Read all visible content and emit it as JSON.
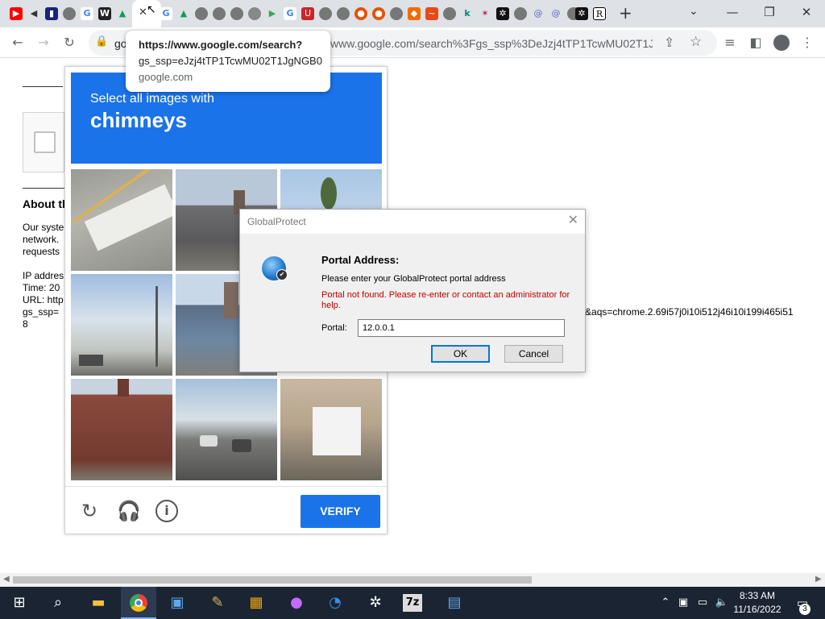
{
  "browser": {
    "tooltip": {
      "url": "https://www.google.com/search?gs_ssp=eJzj4tTP1TcwMU02T1JgNGB0",
      "url_line1": "https://www.google.com/search?",
      "url_line2": "gs_ssp=eJzj4tTP1TcwMU02T1JgNGB0",
      "domain": "google.com"
    },
    "omnibox": {
      "prefix": "go",
      "url": "www.google.com/search%3Fgs_ssp%3DeJzj4tTP1TcwMU02T1Jg..."
    },
    "tab_close": "✕",
    "new_tab": "+",
    "tab_overflow": "⌄"
  },
  "page": {
    "about_heading": "About th",
    "lines": [
      "Our syste",
      "network.",
      "requests"
    ],
    "ip_label": "IP addres",
    "time_label": "Time: 20",
    "url_label": "URL: http",
    "gs_label": "gs_ssp=",
    "eight": "8",
    "url_continued": "ooh&aqs=chrome.2.69i57j0i10i512j46i10i199i465i51"
  },
  "captcha": {
    "prompt": "Select all images with",
    "target": "chimneys",
    "verify_label": "VERIFY"
  },
  "globalprotect": {
    "title": "GlobalProtect",
    "heading": "Portal Address:",
    "instruction": "Please enter your GlobalProtect portal address",
    "error": "Portal not found. Please re-enter or contact an administrator for help.",
    "portal_label": "Portal:",
    "portal_value": "12.0.0.1",
    "ok_label": "OK",
    "cancel_label": "Cancel"
  },
  "taskbar": {
    "time": "8:33 AM",
    "date": "11/16/2022",
    "notification_count": "3"
  },
  "colors": {
    "captcha_blue": "#1a73e8",
    "error_red": "#c00000",
    "taskbar": "#1b2433"
  }
}
